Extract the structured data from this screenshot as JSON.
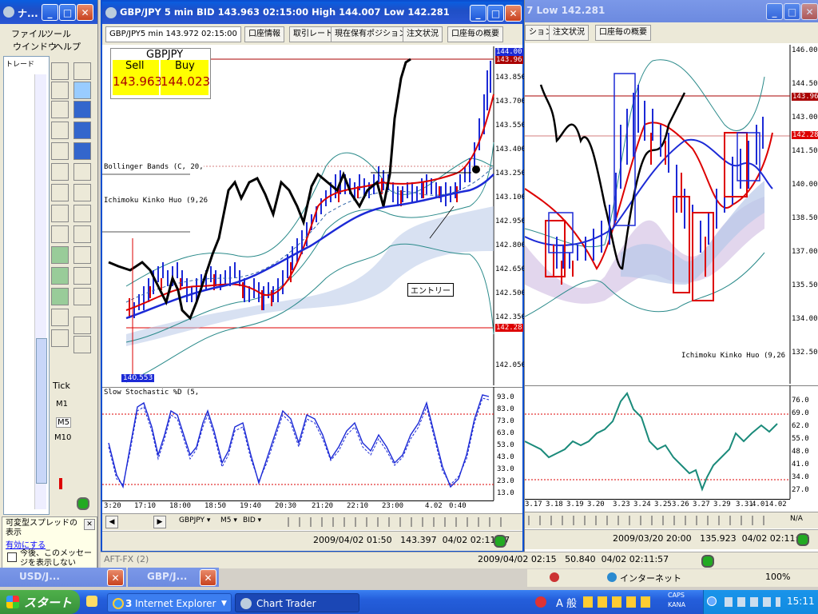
{
  "left_window": {
    "title": "ナ...",
    "menu": [
      "ファイル",
      "ツール",
      "ウインドウ",
      "ヘルプ"
    ],
    "tab": "トレード"
  },
  "side_tools": {
    "tick_label": "Tick",
    "intervals": [
      "M1",
      "M5",
      "M10"
    ]
  },
  "notice": {
    "line1": "可変型スプレッドの表示",
    "link": "有効にする",
    "checkbox_label": "今後、このメッセージを表示しない"
  },
  "main_window": {
    "title": "GBP/JPY 5 min BID 143.963 02:15:00 High 144.007 Low 142.281",
    "tab_active": "GBP/JPY5 min 143.972 02:15:00",
    "tabs": [
      "口座情報",
      "取引レート",
      "現在保有ポジション",
      "注文状況",
      "口座毎の概要"
    ],
    "symbol": "GBPJPY",
    "sell_label": "Sell",
    "buy_label": "Buy",
    "sell_price": "143.963",
    "buy_price": "144.023",
    "indicator1": "Bollinger Bands (C, 20,",
    "indicator2": "Ichimoku Kinko Huo (9,26",
    "annotation": "エントリー",
    "low_marker": "140.553",
    "price_tag_top1": "144.00",
    "price_tag_top2": "143.96",
    "price_tag_low": "142.28",
    "y_axis": [
      "143.850",
      "143.700",
      "143.550",
      "143.400",
      "143.250",
      "143.100",
      "142.950",
      "142.800",
      "142.650",
      "142.500",
      "142.350",
      "142.200",
      "142.050"
    ],
    "x_axis": [
      "3:20",
      "17:10",
      "18:00",
      "18:50",
      "19:40",
      "20:30",
      "21:20",
      "22:10",
      "23:00",
      "4.02",
      "0:40"
    ],
    "stoch_label": "Slow Stochastic %D  (5,",
    "stoch_axis": [
      "93.0",
      "83.0",
      "73.0",
      "63.0",
      "53.0",
      "43.0",
      "33.0",
      "23.0",
      "13.0"
    ],
    "bottom_toolbar": [
      "GBPJPY ▾",
      "M5 ▾",
      "BID ▾"
    ],
    "status": "2009/04/02 01:50   143.397  04/02 02:11:57"
  },
  "right_window": {
    "title_fragment": "7 Low 142.281",
    "tabs": [
      "ション",
      "注文状況",
      "口座毎の概要"
    ],
    "price_tag": "143.96",
    "price_tag2": "142.28",
    "y_axis": [
      "146.00",
      "144.50",
      "143.00",
      "141.50",
      "140.00",
      "138.50",
      "137.00",
      "135.50",
      "134.00",
      "132.50"
    ],
    "indicator": "Ichimoku Kinko Huo (9,26",
    "stoch_axis": [
      "76.0",
      "69.0",
      "62.0",
      "55.0",
      "48.0",
      "41.0",
      "34.0",
      "27.0"
    ],
    "x_axis": [
      "3.17",
      "3.18",
      "3.19",
      "3.20",
      "3.23",
      "3.24",
      "3.25",
      "3.26",
      "3.27",
      "3.29",
      "3.31",
      "4.01",
      "4.02"
    ],
    "na": "N/A",
    "status": "2009/03/20 20:00   135.923  04/02 02:11:57"
  },
  "lower_strip": {
    "left_title": "AFT-FX (2)",
    "status": "2009/04/02 02:15   50.840  04/02 02:11:57"
  },
  "back_windows": {
    "w1": "USD/J...",
    "w2": "GBP/J..."
  },
  "ie_status": {
    "zone": "インターネット",
    "zoom": "100%"
  },
  "taskbar": {
    "start": "スタート",
    "ie": "Internet Explorer",
    "ie_count": "3",
    "chart": "Chart Trader",
    "ime": "A 般",
    "caps": "CAPS",
    "kana": "KANA",
    "time": "15:11"
  }
}
